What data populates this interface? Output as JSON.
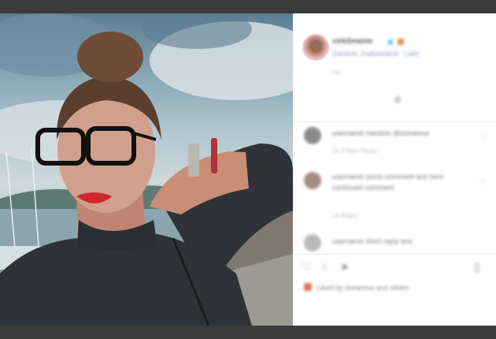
{
  "colors": {
    "frame": "#3b3b3b",
    "link": "#7e9fcf"
  },
  "post": {
    "photo_label": "",
    "username": "celebname",
    "location": "Geneva, Switzerland · Lake",
    "time_ago": "1d"
  },
  "comments": [
    {
      "text": "username mention @someone",
      "meta": "1d   3 likes   Reply"
    },
    {
      "text": "username some comment text here",
      "text2": "continued comment",
      "meta": "1d   Reply"
    },
    {
      "text": "username short reply text",
      "meta": ""
    }
  ],
  "actions": {
    "like_icon": "heart-icon",
    "comment_icon": "comment-icon",
    "share_icon": "share-icon",
    "save_icon": "bookmark-icon"
  },
  "likes_text": "Liked by someone and others"
}
